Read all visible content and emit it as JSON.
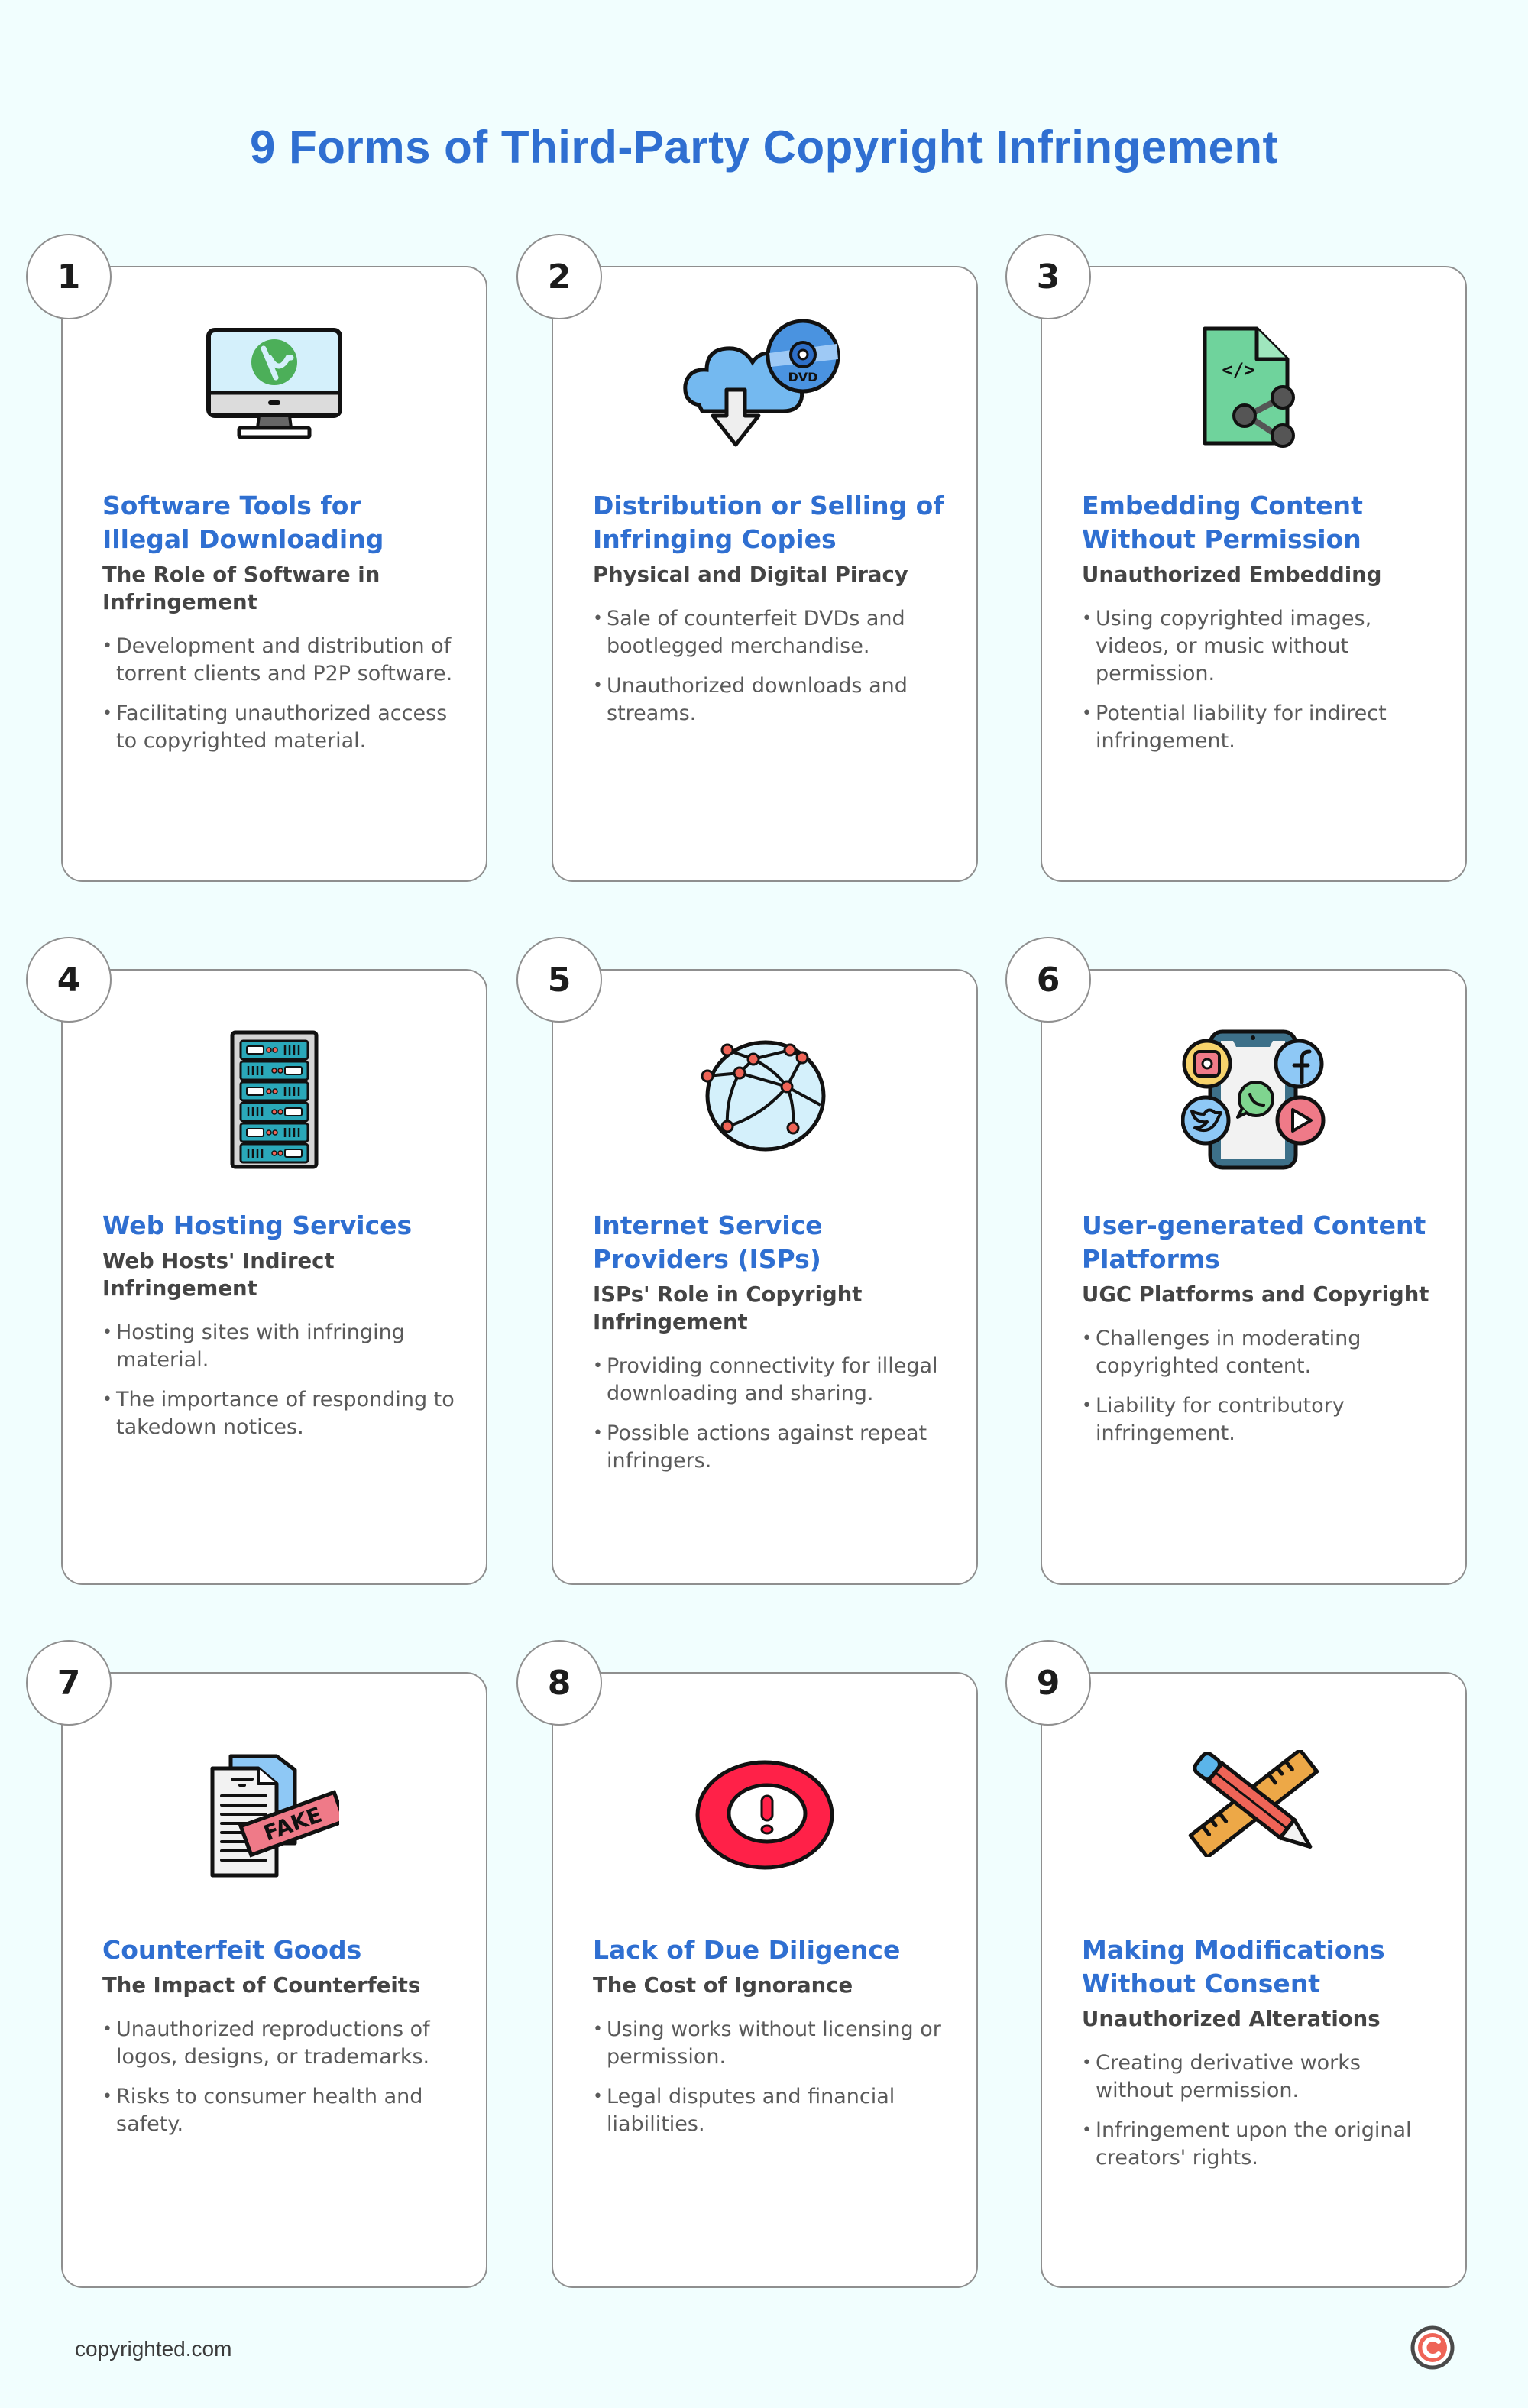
{
  "page": {
    "title": "9 Forms of Third-Party Copyright Infringement",
    "footer_site": "copyrighted.com",
    "footer_logo_icon": "copyright-icon",
    "colors": {
      "background": "#f1fefe",
      "title_blue": "#2f6fd1",
      "subtitle_gray": "#444444",
      "body_gray": "#5a5a5a",
      "card_border": "#8f8f8f",
      "logo_red": "#ef6457"
    }
  },
  "cards": [
    {
      "number": "1",
      "icon": "computer-torrent-icon",
      "title": "Software Tools for Illegal Downloading",
      "subtitle": "The Role of Software in Infringement",
      "bullets": [
        "Development and distribution of torrent clients and P2P software.",
        "Facilitating unauthorized access to copyrighted material."
      ]
    },
    {
      "number": "2",
      "icon": "cloud-download-dvd-icon",
      "icon_label": "DVD",
      "title": "Distribution or Selling of Infringing Copies",
      "subtitle": "Physical and Digital Piracy",
      "bullets": [
        "Sale of counterfeit DVDs and bootlegged merchandise.",
        "Unauthorized downloads and streams."
      ]
    },
    {
      "number": "3",
      "icon": "code-file-share-icon",
      "title": "Embedding Content Without Permission",
      "subtitle": "Unauthorized Embedding",
      "bullets": [
        "Using copyrighted images, videos, or music without permission.",
        "Potential liability for indirect infringement."
      ]
    },
    {
      "number": "4",
      "icon": "server-rack-icon",
      "title": "Web Hosting Services",
      "subtitle": "Web Hosts' Indirect Infringement",
      "bullets": [
        "Hosting sites with infringing material.",
        "The importance of responding to takedown notices."
      ]
    },
    {
      "number": "5",
      "icon": "network-globe-icon",
      "title": "Internet Service Providers (ISPs)",
      "subtitle": "ISPs' Role in Copyright Infringement",
      "bullets": [
        "Providing connectivity for illegal downloading and sharing.",
        "Possible actions against repeat infringers."
      ]
    },
    {
      "number": "6",
      "icon": "smartphone-social-media-icon",
      "title": "User-generated Content Platforms",
      "subtitle": "UGC Platforms and Copyright",
      "bullets": [
        "Challenges in moderating copyrighted content.",
        "Liability for contributory infringement."
      ]
    },
    {
      "number": "7",
      "icon": "fake-document-icon",
      "icon_label": "FAKE",
      "title": "Counterfeit Goods",
      "subtitle": "The Impact of Counterfeits",
      "bullets": [
        "Unauthorized reproductions of logos, designs, or trademarks.",
        "Risks to consumer health and safety."
      ]
    },
    {
      "number": "8",
      "icon": "warning-exclamation-icon",
      "title": "Lack of Due Diligence",
      "subtitle": "The Cost of Ignorance",
      "bullets": [
        "Using works without licensing or permission.",
        "Legal disputes and financial liabilities."
      ]
    },
    {
      "number": "9",
      "icon": "pencil-ruler-icon",
      "title": "Making Modifications Without Consent",
      "subtitle": "Unauthorized Alterations",
      "bullets": [
        "Creating derivative works without permission.",
        "Infringement upon the original creators' rights."
      ]
    }
  ]
}
